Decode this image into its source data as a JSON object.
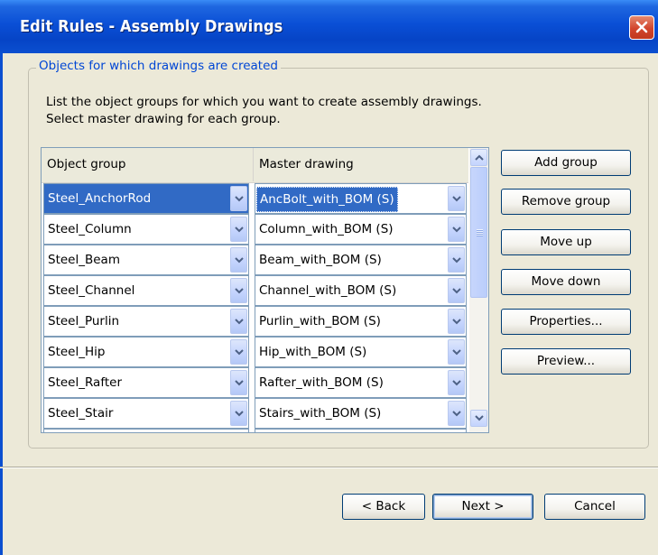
{
  "window": {
    "title": "Edit Rules - Assembly Drawings"
  },
  "groupbox": {
    "legend": "Objects for which drawings are created",
    "desc1": "List the object groups for which you want to create assembly drawings.",
    "desc2": "Select master drawing for each group."
  },
  "grid": {
    "headers": [
      "Object group",
      "Master drawing"
    ],
    "rows": [
      {
        "group": "Steel_AnchorRod",
        "master": "AncBolt_with_BOM (S)",
        "selected": true
      },
      {
        "group": "Steel_Column",
        "master": "Column_with_BOM (S)"
      },
      {
        "group": "Steel_Beam",
        "master": "Beam_with_BOM (S)"
      },
      {
        "group": "Steel_Channel",
        "master": "Channel_with_BOM (S)"
      },
      {
        "group": "Steel_Purlin",
        "master": "Purlin_with_BOM (S)"
      },
      {
        "group": "Steel_Hip",
        "master": "Hip_with_BOM (S)"
      },
      {
        "group": "Steel_Rafter",
        "master": "Rafter_with_BOM (S)"
      },
      {
        "group": "Steel_Stair",
        "master": "Stairs_with_BOM (S)"
      }
    ]
  },
  "side_buttons": {
    "add_group": "Add group",
    "remove_group": "Remove group",
    "move_up": "Move up",
    "move_down": "Move down",
    "properties": "Properties...",
    "preview": "Preview..."
  },
  "footer": {
    "back": "< Back",
    "next": "Next >",
    "cancel": "Cancel"
  },
  "colors": {
    "title_bar": "#0a4fd6",
    "selection": "#316ac5",
    "dialog_bg": "#ece9d8"
  }
}
